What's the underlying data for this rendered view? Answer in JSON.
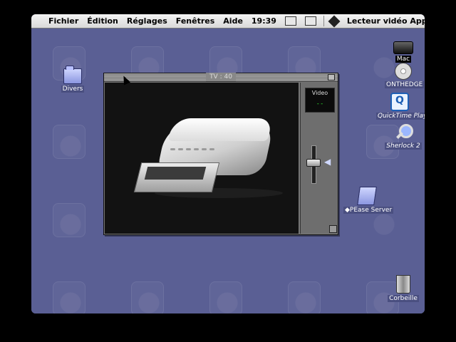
{
  "menubar": {
    "items": [
      "Fichier",
      "Édition",
      "Réglages",
      "Fenêtres",
      "Aide"
    ],
    "clock": "19:39",
    "app_name": "Lecteur vidéo Apple"
  },
  "desktop_icons": {
    "divers": "Divers",
    "mac": "Mac",
    "onthedge": "ONTHEDGE",
    "quicktime": "QuickTime Play",
    "sherlock": "Sherlock 2",
    "server": "◆PEase Server",
    "trash": "Corbeille"
  },
  "video_window": {
    "title": "TV : 40",
    "side_panel_label": "Video",
    "led_text": "- -"
  },
  "icons": [
    "apple-menu-icon",
    "printer-icon",
    "monitor-icon",
    "app-icon",
    "folder-icon",
    "hard-drive-icon",
    "cd-icon",
    "quicktime-icon",
    "sherlock-icon",
    "server-icon",
    "trash-icon",
    "speaker-icon"
  ]
}
